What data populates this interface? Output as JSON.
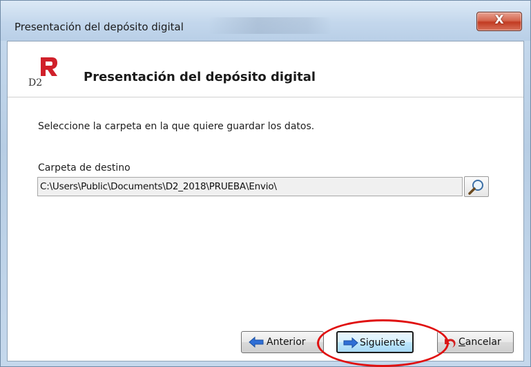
{
  "window": {
    "title": "Presentación del depósito digital",
    "close_label": "X"
  },
  "header": {
    "logo_alt": "D2",
    "title": "Presentación del depósito digital",
    "logo_icon": "d2-logo-icon",
    "brand_color": "#d0202a"
  },
  "main": {
    "instruction": "Seleccione la carpeta en la que quiere guardar los datos.",
    "destination_label": "Carpeta de destino",
    "destination_value": "C:\\Users\\Public\\Documents\\D2_2018\\PRUEBA\\Envio\\",
    "browse_icon": "magnifier-icon"
  },
  "buttons": {
    "previous": "Anterior",
    "next": "Siguiente",
    "cancel_prefix": "C",
    "cancel_rest": "ancelar"
  },
  "colors": {
    "annotation": "#e01010",
    "arrow_blue": "#2f6fd6",
    "cancel_red": "#d42020"
  }
}
